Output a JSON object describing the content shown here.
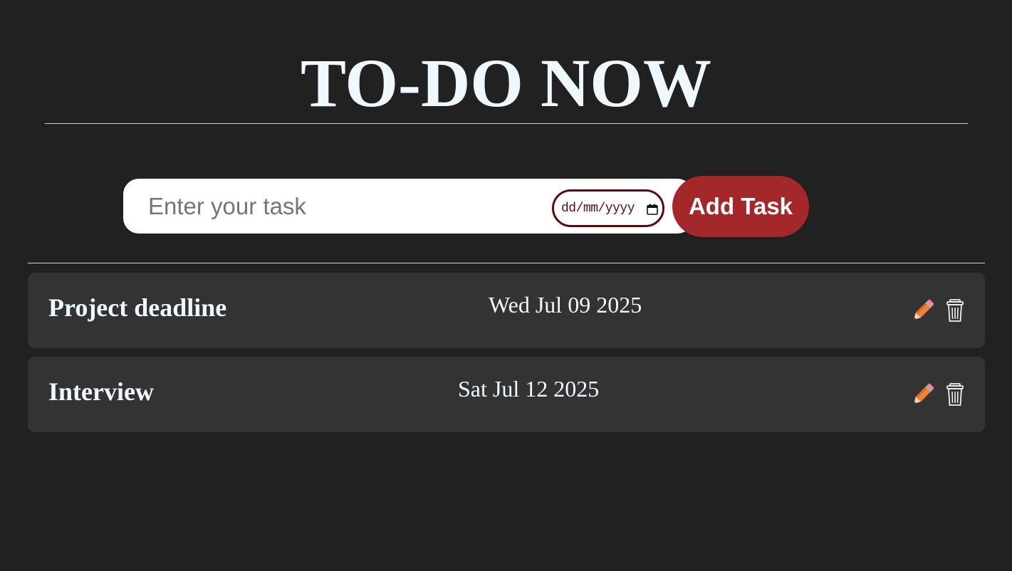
{
  "header": {
    "title": "TO-DO NOW"
  },
  "form": {
    "task_placeholder": "Enter your task",
    "task_value": "",
    "date_placeholder": "dd/mm/yyyy",
    "add_label": "Add Task"
  },
  "tasks": [
    {
      "name": "Project deadline",
      "date": "Wed Jul 09 2025"
    },
    {
      "name": "Interview",
      "date": "Sat Jul 12 2025"
    }
  ],
  "icons": {
    "edit": "pencil-icon",
    "delete": "trash-icon",
    "calendar": "calendar-icon"
  },
  "colors": {
    "background": "#212121",
    "card": "#333333",
    "accent": "#a4282a",
    "date_border": "#5a0a0a",
    "text": "#f0f8ff"
  }
}
